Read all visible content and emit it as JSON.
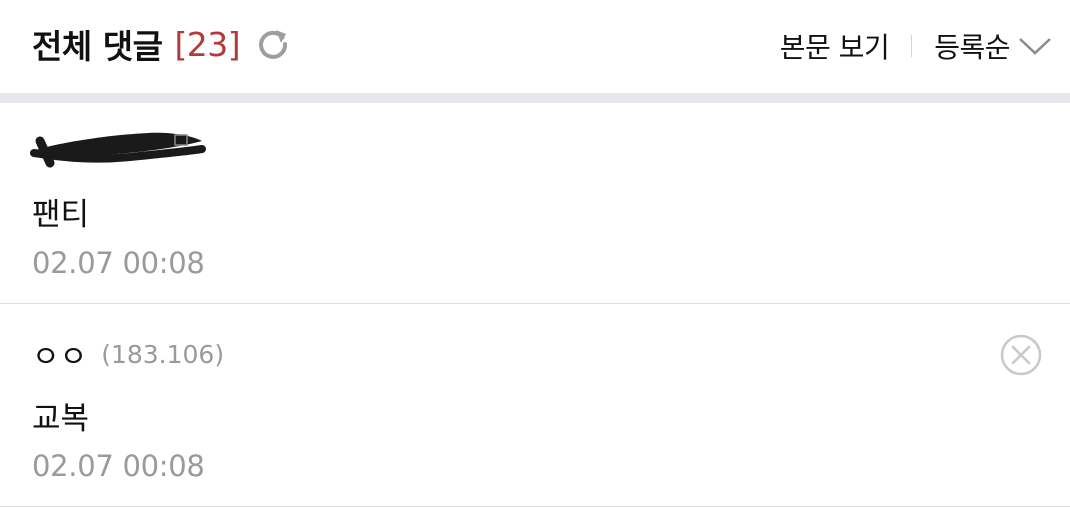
{
  "header": {
    "title": "전체 댓글",
    "count": "[23]",
    "refresh_icon": "refresh-icon",
    "view_body_label": "본문 보기",
    "sort_label": "등록순",
    "sort_icon": "chevron-down-icon"
  },
  "comments": [
    {
      "author": "",
      "author_redacted": true,
      "text": "팬티",
      "date": "02.07 00:08"
    },
    {
      "author": "ㅇㅇ",
      "ip": "(183.106)",
      "text": "교복",
      "date": "02.07 00:08",
      "delete_icon": "close-circle-icon"
    }
  ],
  "colors": {
    "count": "#b23a3a",
    "secondary_text": "#9a9a9a",
    "separator_bar": "#e6e6ee",
    "row_divider": "#dedede"
  }
}
